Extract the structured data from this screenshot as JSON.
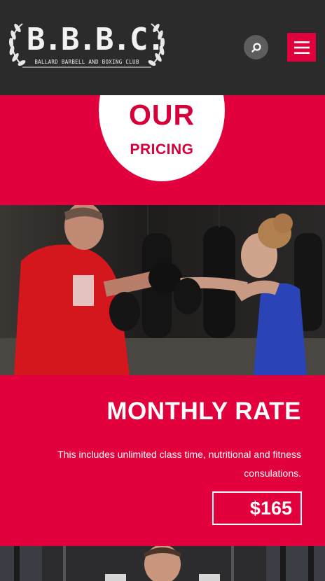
{
  "header": {
    "logo_letters": "B.B.B.C.",
    "logo_tagline": "BALLARD BARBELL AND BOXING CLUB",
    "search_icon": "search-icon",
    "menu_icon": "hamburger-icon",
    "accent": "#e0003c"
  },
  "pricing": {
    "heading_big": "OUR",
    "heading_small": "PRICING",
    "band_color": "#e2003d"
  },
  "photo_top": {
    "alt": "boxing-training-photo"
  },
  "plan": {
    "title": "MONTHLY RATE",
    "description": "This includes unlimited class time, nutritional and fitness consulations.",
    "price": "$165"
  },
  "photo_bottom": {
    "alt": "gym-member-photo"
  }
}
